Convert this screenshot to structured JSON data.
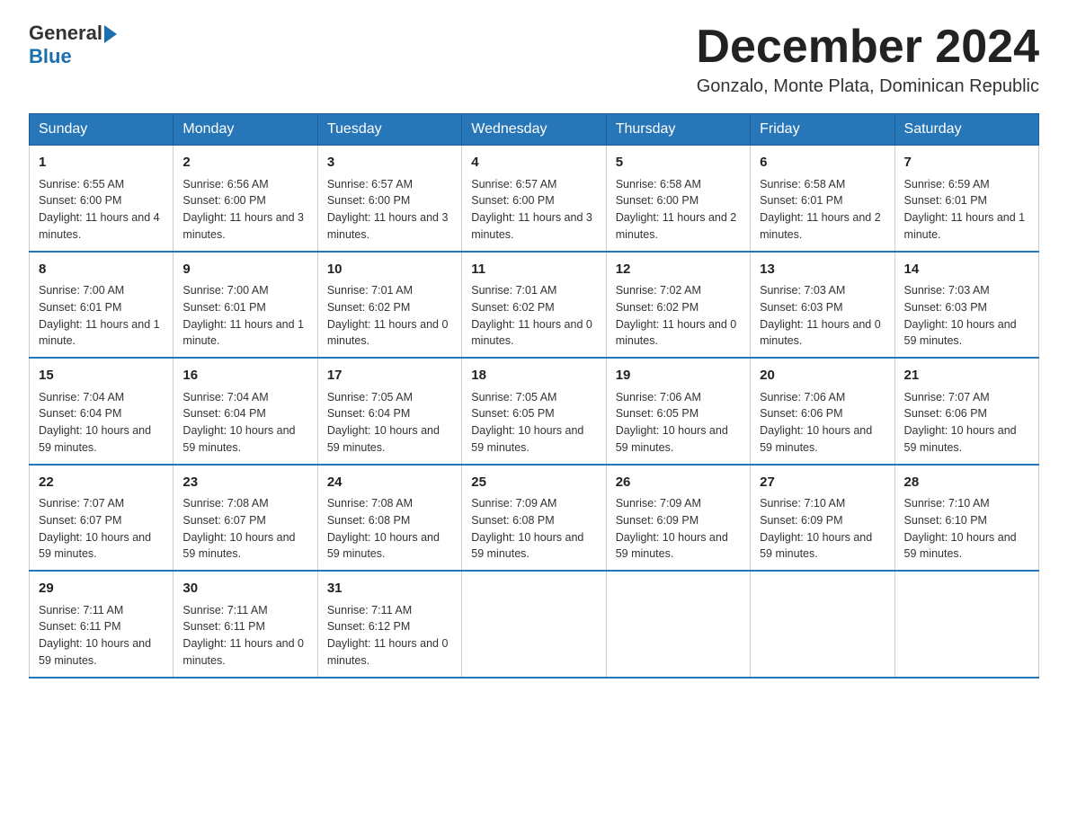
{
  "logo": {
    "general": "General",
    "blue": "Blue"
  },
  "title": "December 2024",
  "location": "Gonzalo, Monte Plata, Dominican Republic",
  "days_of_week": [
    "Sunday",
    "Monday",
    "Tuesday",
    "Wednesday",
    "Thursday",
    "Friday",
    "Saturday"
  ],
  "weeks": [
    [
      {
        "day": "1",
        "sunrise": "6:55 AM",
        "sunset": "6:00 PM",
        "daylight": "11 hours and 4 minutes."
      },
      {
        "day": "2",
        "sunrise": "6:56 AM",
        "sunset": "6:00 PM",
        "daylight": "11 hours and 3 minutes."
      },
      {
        "day": "3",
        "sunrise": "6:57 AM",
        "sunset": "6:00 PM",
        "daylight": "11 hours and 3 minutes."
      },
      {
        "day": "4",
        "sunrise": "6:57 AM",
        "sunset": "6:00 PM",
        "daylight": "11 hours and 3 minutes."
      },
      {
        "day": "5",
        "sunrise": "6:58 AM",
        "sunset": "6:00 PM",
        "daylight": "11 hours and 2 minutes."
      },
      {
        "day": "6",
        "sunrise": "6:58 AM",
        "sunset": "6:01 PM",
        "daylight": "11 hours and 2 minutes."
      },
      {
        "day": "7",
        "sunrise": "6:59 AM",
        "sunset": "6:01 PM",
        "daylight": "11 hours and 1 minute."
      }
    ],
    [
      {
        "day": "8",
        "sunrise": "7:00 AM",
        "sunset": "6:01 PM",
        "daylight": "11 hours and 1 minute."
      },
      {
        "day": "9",
        "sunrise": "7:00 AM",
        "sunset": "6:01 PM",
        "daylight": "11 hours and 1 minute."
      },
      {
        "day": "10",
        "sunrise": "7:01 AM",
        "sunset": "6:02 PM",
        "daylight": "11 hours and 0 minutes."
      },
      {
        "day": "11",
        "sunrise": "7:01 AM",
        "sunset": "6:02 PM",
        "daylight": "11 hours and 0 minutes."
      },
      {
        "day": "12",
        "sunrise": "7:02 AM",
        "sunset": "6:02 PM",
        "daylight": "11 hours and 0 minutes."
      },
      {
        "day": "13",
        "sunrise": "7:03 AM",
        "sunset": "6:03 PM",
        "daylight": "11 hours and 0 minutes."
      },
      {
        "day": "14",
        "sunrise": "7:03 AM",
        "sunset": "6:03 PM",
        "daylight": "10 hours and 59 minutes."
      }
    ],
    [
      {
        "day": "15",
        "sunrise": "7:04 AM",
        "sunset": "6:04 PM",
        "daylight": "10 hours and 59 minutes."
      },
      {
        "day": "16",
        "sunrise": "7:04 AM",
        "sunset": "6:04 PM",
        "daylight": "10 hours and 59 minutes."
      },
      {
        "day": "17",
        "sunrise": "7:05 AM",
        "sunset": "6:04 PM",
        "daylight": "10 hours and 59 minutes."
      },
      {
        "day": "18",
        "sunrise": "7:05 AM",
        "sunset": "6:05 PM",
        "daylight": "10 hours and 59 minutes."
      },
      {
        "day": "19",
        "sunrise": "7:06 AM",
        "sunset": "6:05 PM",
        "daylight": "10 hours and 59 minutes."
      },
      {
        "day": "20",
        "sunrise": "7:06 AM",
        "sunset": "6:06 PM",
        "daylight": "10 hours and 59 minutes."
      },
      {
        "day": "21",
        "sunrise": "7:07 AM",
        "sunset": "6:06 PM",
        "daylight": "10 hours and 59 minutes."
      }
    ],
    [
      {
        "day": "22",
        "sunrise": "7:07 AM",
        "sunset": "6:07 PM",
        "daylight": "10 hours and 59 minutes."
      },
      {
        "day": "23",
        "sunrise": "7:08 AM",
        "sunset": "6:07 PM",
        "daylight": "10 hours and 59 minutes."
      },
      {
        "day": "24",
        "sunrise": "7:08 AM",
        "sunset": "6:08 PM",
        "daylight": "10 hours and 59 minutes."
      },
      {
        "day": "25",
        "sunrise": "7:09 AM",
        "sunset": "6:08 PM",
        "daylight": "10 hours and 59 minutes."
      },
      {
        "day": "26",
        "sunrise": "7:09 AM",
        "sunset": "6:09 PM",
        "daylight": "10 hours and 59 minutes."
      },
      {
        "day": "27",
        "sunrise": "7:10 AM",
        "sunset": "6:09 PM",
        "daylight": "10 hours and 59 minutes."
      },
      {
        "day": "28",
        "sunrise": "7:10 AM",
        "sunset": "6:10 PM",
        "daylight": "10 hours and 59 minutes."
      }
    ],
    [
      {
        "day": "29",
        "sunrise": "7:11 AM",
        "sunset": "6:11 PM",
        "daylight": "10 hours and 59 minutes."
      },
      {
        "day": "30",
        "sunrise": "7:11 AM",
        "sunset": "6:11 PM",
        "daylight": "11 hours and 0 minutes."
      },
      {
        "day": "31",
        "sunrise": "7:11 AM",
        "sunset": "6:12 PM",
        "daylight": "11 hours and 0 minutes."
      },
      null,
      null,
      null,
      null
    ]
  ],
  "labels": {
    "sunrise_prefix": "Sunrise: ",
    "sunset_prefix": "Sunset: ",
    "daylight_prefix": "Daylight: "
  }
}
